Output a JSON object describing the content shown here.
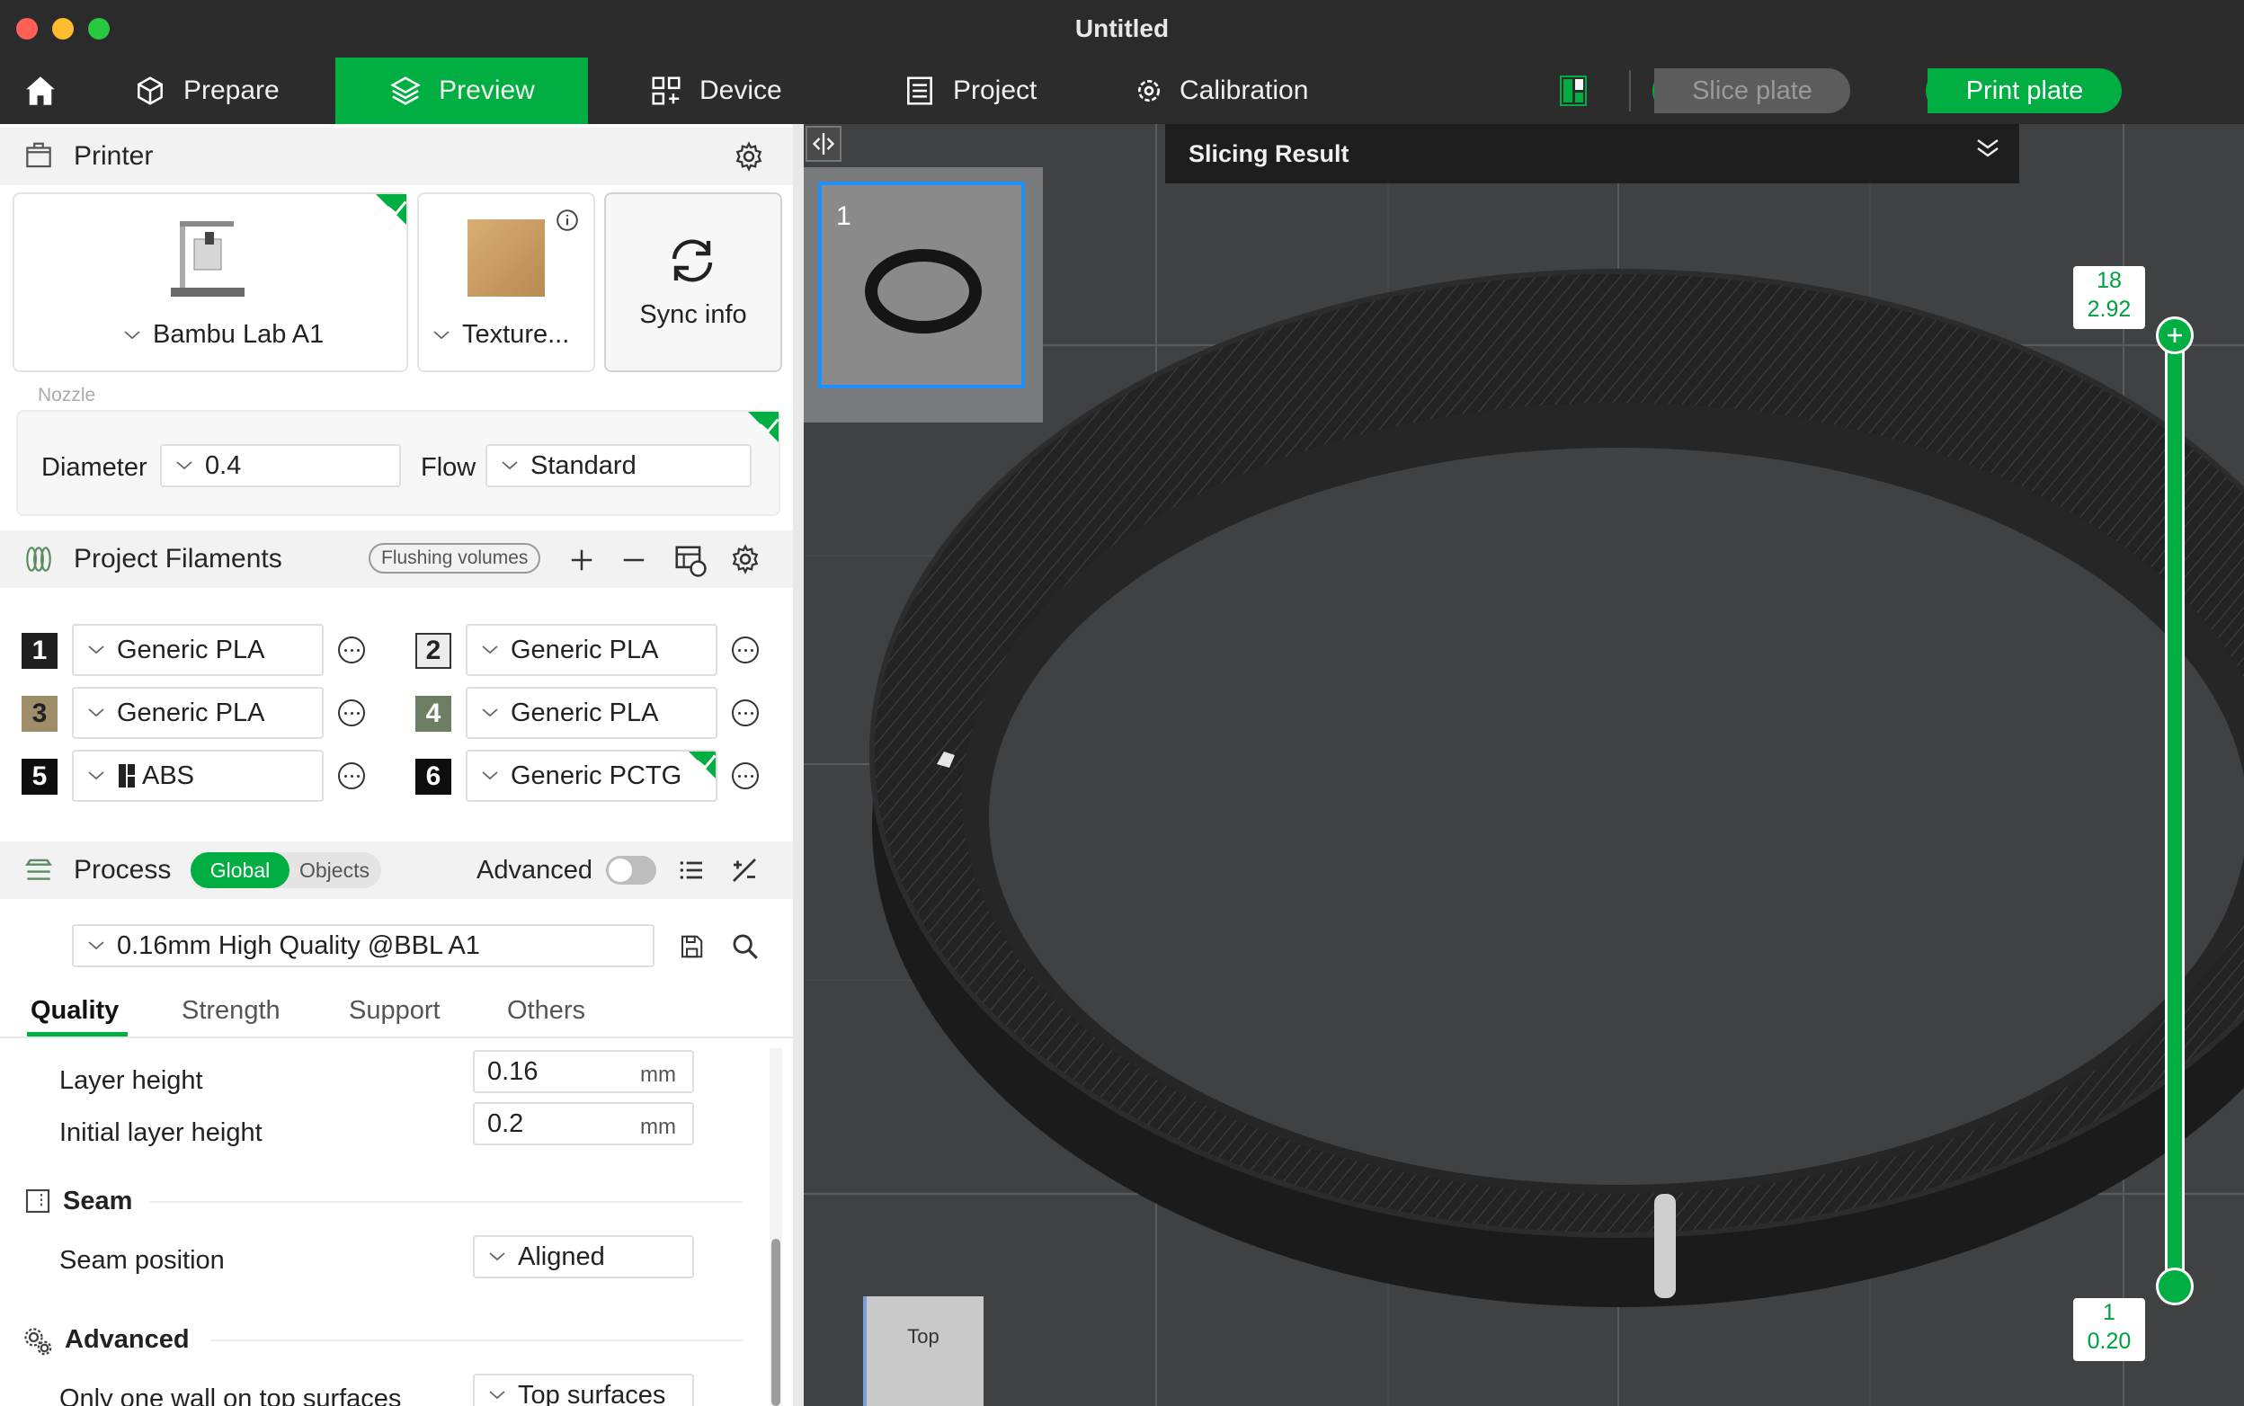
{
  "window": {
    "title": "Untitled"
  },
  "toolbar": {
    "tabs": [
      {
        "label": "Prepare",
        "icon": "cube-icon"
      },
      {
        "label": "Preview",
        "icon": "layers-icon",
        "active": true
      },
      {
        "label": "Device",
        "icon": "device-icon"
      },
      {
        "label": "Project",
        "icon": "project-icon"
      },
      {
        "label": "Calibration",
        "icon": "calibration-icon"
      }
    ],
    "slice_label": "Slice plate",
    "print_label": "Print plate",
    "accent": "#00ae42"
  },
  "printer": {
    "title": "Printer",
    "model": "Bambu Lab A1",
    "plate": "Texture...",
    "sync_label": "Sync info",
    "nozzle_label": "Nozzle",
    "diameter_label": "Diameter",
    "diameter_value": "0.4",
    "flow_label": "Flow",
    "flow_value": "Standard"
  },
  "filaments": {
    "title": "Project Filaments",
    "flushing_label": "Flushing volumes",
    "items": [
      {
        "num": "1",
        "name": "Generic PLA",
        "color": "#1f1f1f",
        "text_color": "#ffffff"
      },
      {
        "num": "2",
        "name": "Generic PLA",
        "color": "#ececec",
        "text_color": "#222222"
      },
      {
        "num": "3",
        "name": "Generic PLA",
        "color": "#a08d6a",
        "text_color": "#222222"
      },
      {
        "num": "4",
        "name": "Generic PLA",
        "color": "#6d7f63",
        "text_color": "#ffffff"
      },
      {
        "num": "5",
        "name": "ABS",
        "color": "#0e0e0e",
        "text_color": "#ffffff"
      },
      {
        "num": "6",
        "name": "Generic PCTG",
        "color": "#0e0e0e",
        "text_color": "#ffffff"
      }
    ]
  },
  "process": {
    "title": "Process",
    "global_label": "Global",
    "objects_label": "Objects",
    "advanced_label": "Advanced",
    "preset": "0.16mm High Quality @BBL A1",
    "tabs": [
      "Quality",
      "Strength",
      "Support",
      "Others"
    ],
    "layer_height_label": "Layer height",
    "layer_height_value": "0.16",
    "initial_layer_label": "Initial layer height",
    "initial_layer_value": "0.2",
    "unit": "mm",
    "seam_title": "Seam",
    "seam_position_label": "Seam position",
    "seam_position_value": "Aligned",
    "advanced_title": "Advanced",
    "one_wall_label": "Only one wall on top surfaces",
    "one_wall_value": "Top surfaces"
  },
  "viewport": {
    "slicing_result_label": "Slicing Result",
    "plate_number": "1",
    "layer_top_num": "18",
    "layer_top_height": "2.92",
    "layer_bottom_num": "1",
    "layer_bottom_height": "0.20",
    "view_cube_label": "Top"
  }
}
